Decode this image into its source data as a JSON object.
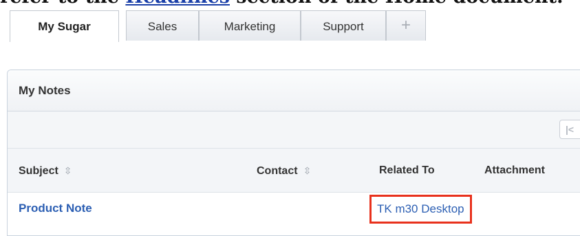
{
  "doc_heading": {
    "prefix": "refer to the ",
    "link": "Headlines",
    "suffix": " section of the Home document."
  },
  "tabs": [
    {
      "label": "My Sugar",
      "active": true
    },
    {
      "label": "Sales",
      "active": false
    },
    {
      "label": "Marketing",
      "active": false
    },
    {
      "label": "Support",
      "active": false
    },
    {
      "label": "+",
      "active": false
    }
  ],
  "dashlet": {
    "title": "My Notes",
    "pager_start_label": "|<",
    "columns": [
      {
        "label": "Subject",
        "sortable": true
      },
      {
        "label": "Contact",
        "sortable": true
      },
      {
        "label": "Related To",
        "sortable": false
      },
      {
        "label": "Attachment",
        "sortable": false
      }
    ],
    "rows": [
      {
        "subject": "Product Note",
        "contact": "",
        "related_to": "TK m30 Desktop",
        "attachment": ""
      }
    ],
    "sort_icon": "sort-arrows-icon",
    "highlight_color": "#e8311c",
    "link_color": "#2c5fb3"
  }
}
